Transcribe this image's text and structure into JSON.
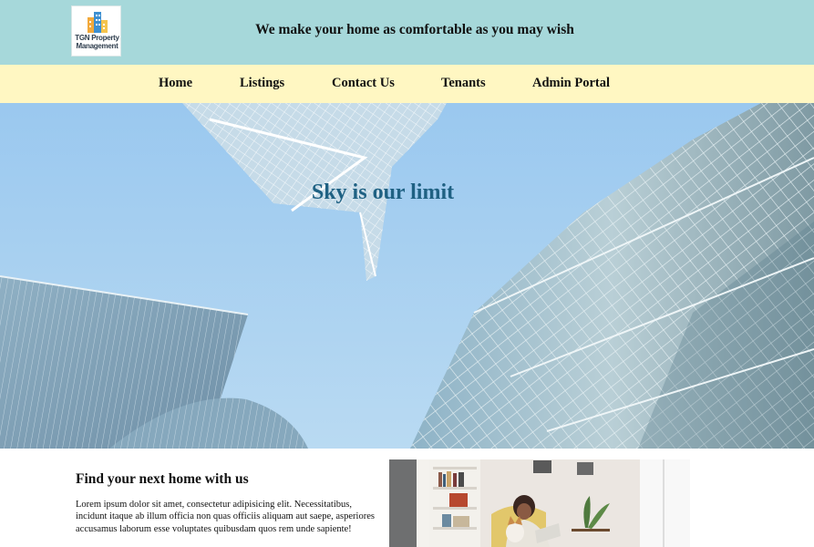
{
  "header": {
    "logo_text_line1": "TGN Property",
    "logo_text_line2": "Management",
    "tagline": "We make your home as comfortable as you may wish"
  },
  "nav": {
    "items": [
      {
        "label": "Home"
      },
      {
        "label": "Listings"
      },
      {
        "label": "Contact Us"
      },
      {
        "label": "Tenants"
      },
      {
        "label": "Admin Portal"
      }
    ]
  },
  "hero": {
    "title": "Sky is our limit"
  },
  "content": {
    "heading": "Find your next home with us",
    "body": "Lorem ipsum dolor sit amet, consectetur adipisicing elit. Necessitatibus, incidunt itaque ab illum officia non quas officiis aliquam aut saepe, asperiores accusamus laborum esse voluptates quibusdam quos rem unde sapiente!"
  },
  "colors": {
    "header_bg": "#a6d8da",
    "nav_bg": "#fff7c2",
    "hero_title": "#1f6183"
  }
}
